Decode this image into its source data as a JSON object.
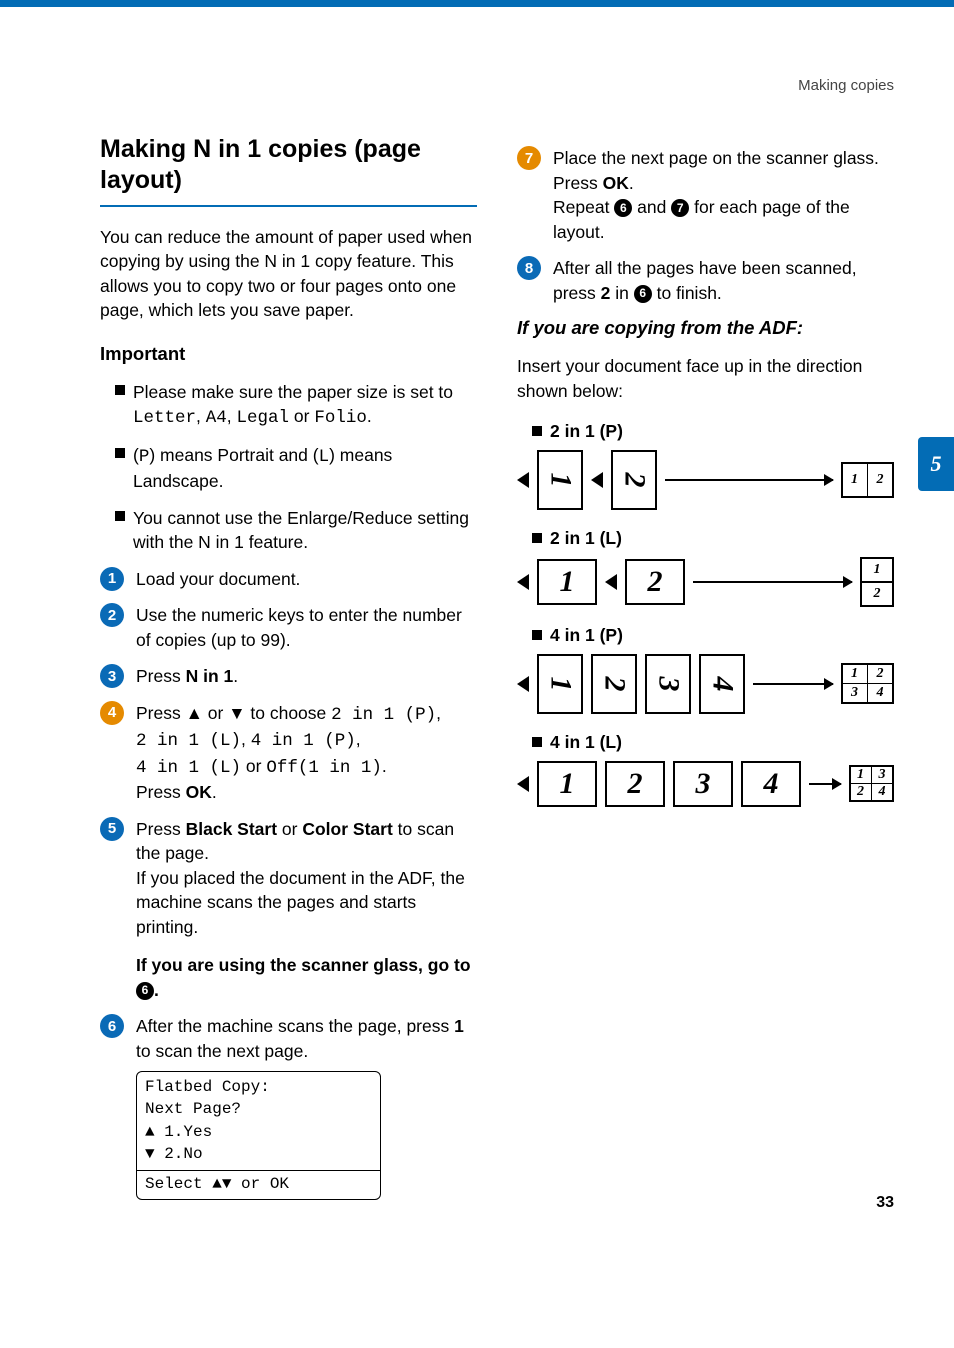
{
  "header": {
    "breadcrumb": "Making copies"
  },
  "chapter_tab": "5",
  "page_number": "33",
  "title": "Making N in 1 copies (page layout)",
  "intro": "You can reduce the amount of paper used when copying by using the N in 1 copy feature. This allows you to copy two or four pages onto one page, which lets you save paper.",
  "important": {
    "heading": "Important",
    "items": [
      {
        "pre": "Please make sure the paper size is set to ",
        "mono": "Letter",
        "mid1": ", ",
        "mono2": "A4",
        "mid2": ", ",
        "mono3": "Legal",
        "mid3": " or ",
        "mono4": "Folio",
        "post": "."
      },
      {
        "pre": "(",
        "mono": "P",
        "mid1": ") means Portrait and (",
        "mono2": "L",
        "post": ") means Landscape."
      },
      {
        "pre": "You cannot use the Enlarge/Reduce setting with the N in 1 feature."
      }
    ]
  },
  "steps_left": [
    {
      "n": "1",
      "color": "#0a6ab6",
      "text": "Load your document."
    },
    {
      "n": "2",
      "color": "#0a6ab6",
      "text": "Use the numeric keys to enter the number of copies (up to 99)."
    },
    {
      "n": "3",
      "color": "#0a6ab6",
      "pre": "Press ",
      "bold": "N in 1",
      "post": "."
    },
    {
      "n": "4",
      "color": "#e58a00",
      "line1_pre": "Press ▲ or ▼ to choose ",
      "line1_mono": "2 in 1 (P)",
      "line1_post": ",",
      "line2_mono1": "2 in 1 (L)",
      "line2_mid1": ", ",
      "line2_mono2": "4 in 1 (P)",
      "line2_post": ",",
      "line3_mono1": "4 in 1 (L)",
      "line3_mid1": " or ",
      "line3_mono2": "Off(1 in 1)",
      "line3_post": ".",
      "line4_pre": "Press ",
      "line4_bold": "OK",
      "line4_post": "."
    },
    {
      "n": "5",
      "color": "#0a6ab6",
      "a_pre": "Press ",
      "a_b1": "Black Start",
      "a_mid": " or ",
      "a_b2": "Color Start",
      "a_post": " to scan the page.",
      "b": "If you placed the document in the ADF, the machine scans the pages and starts printing.",
      "c_pre": "If you are using the scanner glass, go to ",
      "c_ref": "6",
      "c_post": "."
    },
    {
      "n": "6",
      "color": "#0a6ab6",
      "pre": "After the machine scans the page, press ",
      "bold": "1",
      "post": " to scan the next page.",
      "lcd": {
        "l1": "Flatbed Copy:",
        "l2": " Next Page?",
        "l3": "▲    1.Yes",
        "l4": "▼    2.No",
        "l5": "Select ▲▼ or OK"
      }
    }
  ],
  "steps_right": [
    {
      "n": "7",
      "color": "#e58a00",
      "a": "Place the next page on the scanner glass.",
      "b_pre": "Press ",
      "b_bold": "OK",
      "b_post": ".",
      "c_pre": "Repeat ",
      "c_r1": "6",
      "c_mid": " and ",
      "c_r2": "7",
      "c_post": " for each page of the layout."
    },
    {
      "n": "8",
      "color": "#0a6ab6",
      "pre": "After all the pages have been scanned, press ",
      "bold": "2",
      "mid": " in ",
      "ref": "6",
      "post": " to finish."
    }
  ],
  "adf": {
    "heading": "If you are copying from the ADF:",
    "intro": "Insert your document face up in the direction shown below:",
    "layouts": [
      {
        "label": "2 in 1 (P)"
      },
      {
        "label": "2 in 1 (L)"
      },
      {
        "label": "4 in 1 (P)"
      },
      {
        "label": "4 in 1 (L)"
      }
    ]
  }
}
